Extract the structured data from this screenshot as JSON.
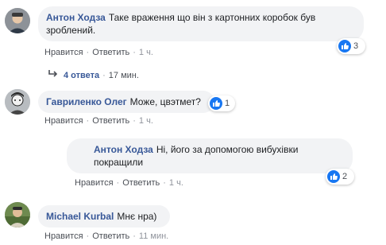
{
  "comments": [
    {
      "author": "Антон Ходза",
      "text": "Таке враження що він з картонних коробок був зроблений.",
      "like_label": "Нравится",
      "reply_label": "Ответить",
      "time": "1 ч.",
      "reactions": "3"
    },
    {
      "author": "Гавриленко Олег",
      "text": "Може, цвэтмет?",
      "like_label": "Нравится",
      "reply_label": "Ответить",
      "time": "1 ч.",
      "reactions": "1"
    },
    {
      "author": "Антон Ходза",
      "text": "Ні, його за допомогою вибухівки покращили",
      "like_label": "Нравится",
      "reply_label": "Ответить",
      "time": "1 ч.",
      "reactions": "2"
    },
    {
      "author": "Michael Kurbal",
      "text": "Мнє нра)",
      "like_label": "Нравится",
      "reply_label": "Ответить",
      "time": "11 мин."
    }
  ],
  "replies_row": {
    "count": "4 ответа",
    "time": "17 мин."
  },
  "colors": {
    "link": "#385898",
    "bubble": "#f2f3f5",
    "like_blue": "#1877f2"
  }
}
